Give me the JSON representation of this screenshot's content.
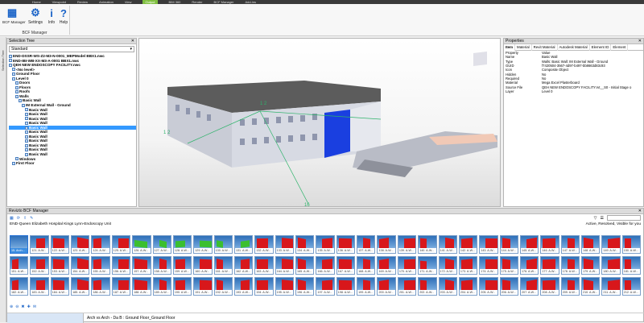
{
  "topbar": {
    "items": [
      "Home",
      "Viewpoint",
      "Review",
      "Animation",
      "View",
      "Output",
      "BIM 360",
      "Render",
      "BCF Manager",
      "Add-ins"
    ],
    "highlight_index": 5
  },
  "ribbon": {
    "buttons": [
      {
        "label": "BCF Manager",
        "icon": "bcf-manager-icon",
        "glyph": "▦"
      },
      {
        "label": "Settings",
        "icon": "gear-icon",
        "glyph": "⚙"
      },
      {
        "label": "Info",
        "icon": "info-icon",
        "glyph": "i"
      },
      {
        "label": "Help",
        "icon": "help-icon",
        "glyph": "?"
      }
    ],
    "group_label": "BCF Manager"
  },
  "left_strip": {
    "label": "Selection Tree"
  },
  "selection_tree": {
    "title": "Selection Tree",
    "dropdown": "Standard",
    "items": [
      {
        "text": "END-DSSR-WS-Z2-M3-N-0001_MEPModel BBX1.nwc",
        "indent": 0,
        "bold": true
      },
      {
        "text": "END-IBI-WB-XX-M3-A-0001 BBX1.nwc",
        "indent": 0,
        "bold": true
      },
      {
        "text": "QEH NEW ENDOSCOPY FACILITY.nwc",
        "indent": 0,
        "bold": true
      },
      {
        "text": "<No level>",
        "indent": 1,
        "bold": true
      },
      {
        "text": "Ground Floor",
        "indent": 1,
        "bold": true
      },
      {
        "text": "Level 0",
        "indent": 1,
        "bold": true
      },
      {
        "text": "Doors",
        "indent": 2,
        "bold": true
      },
      {
        "text": "Floors",
        "indent": 2,
        "bold": true
      },
      {
        "text": "Roofs",
        "indent": 2,
        "bold": true
      },
      {
        "text": "Walls",
        "indent": 2,
        "bold": true
      },
      {
        "text": "Basic Wall",
        "indent": 3,
        "bold": true
      },
      {
        "text": "IM External Wall - Ground",
        "indent": 4,
        "bold": true
      },
      {
        "text": "Basic Wall",
        "indent": 5,
        "bold": true
      },
      {
        "text": "Basic Wall",
        "indent": 5,
        "bold": true
      },
      {
        "text": "Basic Wall",
        "indent": 5,
        "bold": true
      },
      {
        "text": "Basic Wall",
        "indent": 5,
        "bold": true
      },
      {
        "text": "Basic Wall",
        "indent": 5,
        "bold": true,
        "selected": true
      },
      {
        "text": "Basic Wall",
        "indent": 5,
        "bold": true
      },
      {
        "text": "Basic Wall",
        "indent": 5,
        "bold": true
      },
      {
        "text": "Basic Wall",
        "indent": 5,
        "bold": true
      },
      {
        "text": "Basic Wall",
        "indent": 5,
        "bold": true
      },
      {
        "text": "Basic Wall",
        "indent": 5,
        "bold": true
      },
      {
        "text": "Basic Wall",
        "indent": 5,
        "bold": true
      },
      {
        "text": "Windows",
        "indent": 2,
        "bold": true
      },
      {
        "text": "First Floor",
        "indent": 1,
        "bold": true
      }
    ]
  },
  "viewport": {
    "labels": [
      "1 2",
      "1 2",
      "16"
    ]
  },
  "properties": {
    "title": "Properties",
    "tabs": [
      "Item",
      "Material",
      "Revit Material",
      "Autodesk Material",
      "Element ID",
      "Element"
    ],
    "rows": [
      [
        "Property",
        "Value"
      ],
      [
        "Name",
        "Basic Wall"
      ],
      [
        "Type",
        "Walls: Basic Wall: IM External Wall - Ground"
      ],
      [
        "GUID",
        "f7420504-3567-4d97-b497-bb8663d83c93"
      ],
      [
        "Icon",
        "Composite Object"
      ],
      [
        "Hidden",
        "No"
      ],
      [
        "Required",
        "No"
      ],
      [
        "Material",
        "Mega Excel Plasterboard"
      ],
      [
        "Source File",
        "QEH NEW ENDOSCOPY FACILITY.rvt__S0 - Initial Stage o"
      ],
      [
        "Layer",
        "Level 0"
      ]
    ]
  },
  "bcf": {
    "title": "Revizto BCF Manager",
    "project": "END-Queen Elizabeth Hospital Kings Lynn-Endoscopy Unit",
    "filter": "Active, Resolved, Visible for you",
    "row1": [
      {
        "c": "15. Arch...",
        "t": "sel"
      },
      {
        "c": "121. A-W...",
        "t": "r"
      },
      {
        "c": "122. A-W...",
        "t": "r"
      },
      {
        "c": "123. A-W...",
        "t": "r"
      },
      {
        "c": "124. A-W...",
        "t": "r"
      },
      {
        "c": "125. A-W...",
        "t": "r"
      },
      {
        "c": "126. A-W...",
        "t": "g"
      },
      {
        "c": "127. A-W...",
        "t": "g"
      },
      {
        "c": "128. A-W...",
        "t": "g"
      },
      {
        "c": "129. A-W...",
        "t": "g"
      },
      {
        "c": "130. A-W...",
        "t": "g"
      },
      {
        "c": "131. A-W...",
        "t": "g"
      },
      {
        "c": "132. A-W...",
        "t": "r"
      },
      {
        "c": "133. A-W...",
        "t": "r"
      },
      {
        "c": "134. A-W...",
        "t": "r"
      },
      {
        "c": "135. A-W...",
        "t": "r"
      },
      {
        "c": "136. A-W...",
        "t": "r"
      },
      {
        "c": "137. A-W...",
        "t": "r"
      },
      {
        "c": "138. A-W...",
        "t": "r"
      },
      {
        "c": "139. A-W...",
        "t": "r"
      },
      {
        "c": "140. A-W...",
        "t": "r"
      },
      {
        "c": "141. A-W...",
        "t": "r"
      },
      {
        "c": "142. A-W...",
        "t": "r"
      },
      {
        "c": "143. A-W...",
        "t": "r"
      },
      {
        "c": "144. A-W...",
        "t": "r"
      },
      {
        "c": "145. A-W...",
        "t": "r"
      },
      {
        "c": "146. A-W...",
        "t": "r"
      },
      {
        "c": "147. A-W...",
        "t": "r"
      },
      {
        "c": "148. A-W...",
        "t": "r"
      },
      {
        "c": "149. A-W...",
        "t": "r"
      },
      {
        "c": "150. A-W...",
        "t": "r"
      }
    ],
    "row2": [
      {
        "c": "151. A-W...",
        "t": "r"
      },
      {
        "c": "152. A-W...",
        "t": "r"
      },
      {
        "c": "153. A-W...",
        "t": "r"
      },
      {
        "c": "154. A-W...",
        "t": "r"
      },
      {
        "c": "155. A-W...",
        "t": "r"
      },
      {
        "c": "156. A-W...",
        "t": "r"
      },
      {
        "c": "157. A-W...",
        "t": "r"
      },
      {
        "c": "158. A-W...",
        "t": "r"
      },
      {
        "c": "159. A-W...",
        "t": "r"
      },
      {
        "c": "160. A-W...",
        "t": "r"
      },
      {
        "c": "161. A-W...",
        "t": "r"
      },
      {
        "c": "162. A-W...",
        "t": "r"
      },
      {
        "c": "163. A-W...",
        "t": "r"
      },
      {
        "c": "164. A-W...",
        "t": "r"
      },
      {
        "c": "165. A-W...",
        "t": "r"
      },
      {
        "c": "166. A-W...",
        "t": "r"
      },
      {
        "c": "167. A-W...",
        "t": "r"
      },
      {
        "c": "168. A-W...",
        "t": "r"
      },
      {
        "c": "169. A-W...",
        "t": "r"
      },
      {
        "c": "170. A-W...",
        "t": "r"
      },
      {
        "c": "171. A-W...",
        "t": "r2"
      },
      {
        "c": "172. A-W...",
        "t": "r"
      },
      {
        "c": "173. A-W...",
        "t": "r"
      },
      {
        "c": "174. A-W...",
        "t": "r"
      },
      {
        "c": "175. A-W...",
        "t": "r"
      },
      {
        "c": "176. A-W...",
        "t": "r"
      },
      {
        "c": "177. A-W...",
        "t": "r"
      },
      {
        "c": "178. A-W...",
        "t": "r"
      },
      {
        "c": "179. A-W...",
        "t": "r"
      },
      {
        "c": "180. A-W...",
        "t": "r"
      },
      {
        "c": "181. A-W...",
        "t": "r"
      }
    ],
    "row3": [
      {
        "c": "182. A-W...",
        "t": "r"
      },
      {
        "c": "183. A-W...",
        "t": "r"
      },
      {
        "c": "184. A-W...",
        "t": "r"
      },
      {
        "c": "185. A-W...",
        "t": "r"
      },
      {
        "c": "186. A-W...",
        "t": "r"
      },
      {
        "c": "187. A-W...",
        "t": "r"
      },
      {
        "c": "188. A-W...",
        "t": "r"
      },
      {
        "c": "189. A-W...",
        "t": "r"
      },
      {
        "c": "190. A-W...",
        "t": "r"
      },
      {
        "c": "191. A-W...",
        "t": "r"
      },
      {
        "c": "192. A-W...",
        "t": "r"
      },
      {
        "c": "193. A-W...",
        "t": "r"
      },
      {
        "c": "194. A-W...",
        "t": "r"
      },
      {
        "c": "195. A-W...",
        "t": "r"
      },
      {
        "c": "196. A-W...",
        "t": "r"
      },
      {
        "c": "197. A-W...",
        "t": "r"
      },
      {
        "c": "198. A-W...",
        "t": "r"
      },
      {
        "c": "199. A-W...",
        "t": "r"
      },
      {
        "c": "200. A-W...",
        "t": "r"
      },
      {
        "c": "201. A-W...",
        "t": "r"
      },
      {
        "c": "202. A-W...",
        "t": "r"
      },
      {
        "c": "203. A-W...",
        "t": "r"
      },
      {
        "c": "204. A-W...",
        "t": "r"
      },
      {
        "c": "205. A-W...",
        "t": "r"
      },
      {
        "c": "206. A-W...",
        "t": "r"
      },
      {
        "c": "207. A-W...",
        "t": "r"
      },
      {
        "c": "208. A-W...",
        "t": "r"
      },
      {
        "c": "209. A-W...",
        "t": "r"
      },
      {
        "c": "210. A-W...",
        "t": "r"
      },
      {
        "c": "211. A-W...",
        "t": "r"
      },
      {
        "c": "212. A-W...",
        "t": "r"
      }
    ],
    "status_text": "Arch vs Arch - Da B : Ground Floor_Ground Floor"
  }
}
